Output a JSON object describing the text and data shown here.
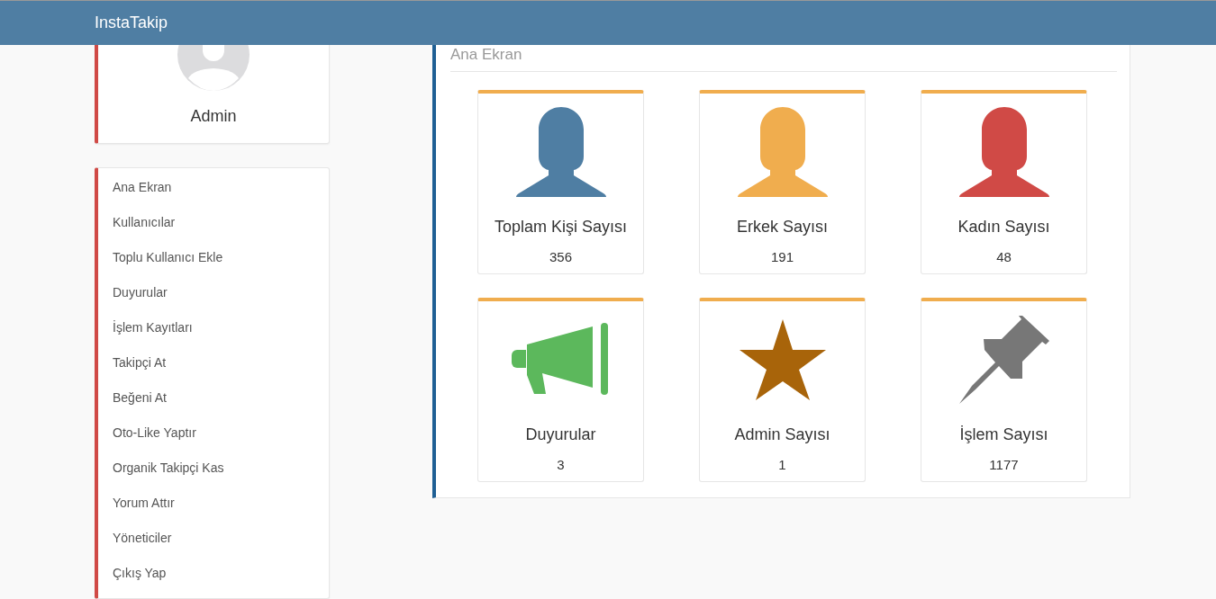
{
  "navbar": {
    "brand": "InstaTakip"
  },
  "profile": {
    "name": "Admin"
  },
  "sidebar": {
    "items": [
      {
        "label": "Ana Ekran"
      },
      {
        "label": "Kullanıcılar"
      },
      {
        "label": "Toplu Kullanıcı Ekle"
      },
      {
        "label": "Duyurular"
      },
      {
        "label": "İşlem Kayıtları"
      },
      {
        "label": "Takipçi At"
      },
      {
        "label": "Beğeni At"
      },
      {
        "label": "Oto-Like Yaptır"
      },
      {
        "label": "Organik Takipçi Kas"
      },
      {
        "label": "Yorum Attır"
      },
      {
        "label": "Yöneticiler"
      },
      {
        "label": "Çıkış Yap"
      }
    ]
  },
  "panel": {
    "title": "Ana Ekran",
    "stats": [
      {
        "kind": "person",
        "color": "#4f7ea3",
        "label": "Toplam Kişi Sayısı",
        "value": "356"
      },
      {
        "kind": "person",
        "color": "#f0ad4e",
        "label": "Erkek Sayısı",
        "value": "191"
      },
      {
        "kind": "person",
        "color": "#d04a46",
        "label": "Kadın Sayısı",
        "value": "48"
      },
      {
        "kind": "megaphone",
        "color": "#5cb85c",
        "label": "Duyurular",
        "value": "3"
      },
      {
        "kind": "star",
        "color": "#a8640a",
        "label": "Admin Sayısı",
        "value": "1"
      },
      {
        "kind": "pin",
        "color": "#777777",
        "label": "İşlem Sayısı",
        "value": "1177"
      }
    ]
  }
}
